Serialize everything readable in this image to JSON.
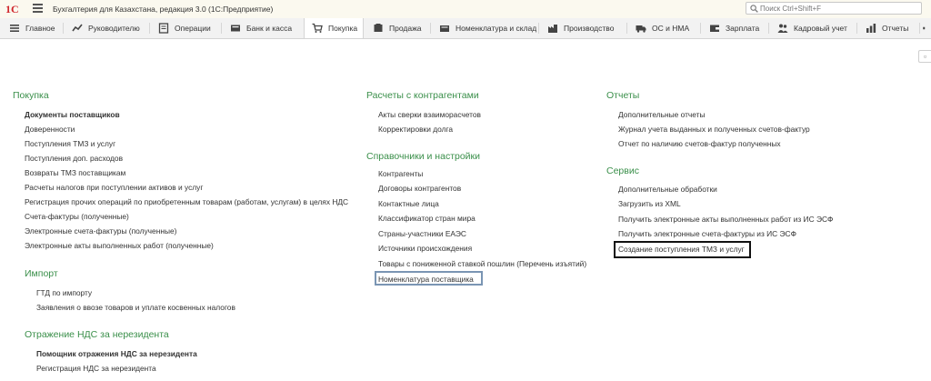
{
  "app": {
    "logo": "1С",
    "title": "Бухгалтерия для Казахстана, редакция 3.0  (1С:Предприятие)",
    "search_placeholder": "Поиск Ctrl+Shift+F"
  },
  "sections": [
    {
      "label": "Главное",
      "icon": "menu-lines-icon"
    },
    {
      "label": "Руководителю",
      "icon": "trend-icon"
    },
    {
      "label": "Операции",
      "icon": "operations-icon"
    },
    {
      "label": "Банк и касса",
      "icon": "bank-icon"
    },
    {
      "label": "Покупка",
      "icon": "cart-icon",
      "active": true
    },
    {
      "label": "Продажа",
      "icon": "sale-icon"
    },
    {
      "label": "Номенклатура и склад",
      "icon": "warehouse-icon"
    },
    {
      "label": "Производство",
      "icon": "factory-icon"
    },
    {
      "label": "ОС и НМА",
      "icon": "truck-icon"
    },
    {
      "label": "Зарплата",
      "icon": "wallet-icon"
    },
    {
      "label": "Кадровый учет",
      "icon": "people-icon"
    },
    {
      "label": "Отчеты",
      "icon": "report-icon"
    }
  ],
  "corner_button": "▫",
  "groups": {
    "pokupka": {
      "title": "Покупка",
      "items": [
        "Документы поставщиков",
        "Доверенности",
        "Поступления ТМЗ и услуг",
        "Поступления доп. расходов",
        "Возвраты ТМЗ поставщикам",
        "Расчеты налогов при поступлении активов и услуг",
        "Регистрация прочих операций по приобретенным товарам (работам, услугам) в целях НДС",
        "Счета-фактуры (полученные)",
        "Электронные счета-фактуры (полученные)",
        "Электронные акты выполненных работ (полученные)"
      ]
    },
    "import": {
      "title": "Импорт",
      "items": [
        "ГТД по импорту",
        "Заявления о ввозе товаров и уплате косвенных налогов"
      ]
    },
    "nds_nonresident": {
      "title": "Отражение НДС за нерезидента",
      "items": [
        "Помощник отражения НДС за нерезидента",
        "Регистрация НДС за нерезидента"
      ]
    },
    "raschety": {
      "title": "Расчеты с контрагентами",
      "items": [
        "Акты сверки взаиморасчетов",
        "Корректировки долга"
      ]
    },
    "spravochniki": {
      "title": "Справочники и настройки",
      "items": [
        "Контрагенты",
        "Договоры контрагентов",
        "Контактные лица",
        "Классификатор стран мира",
        "Страны-участники ЕАЭС",
        "Источники происхождения",
        "Товары с пониженной ставкой пошлин (Перечень изъятий)",
        "Номенклатура поставщика"
      ]
    },
    "otchety": {
      "title": "Отчеты",
      "items": [
        "Дополнительные отчеты",
        "Журнал учета выданных и полученных счетов-фактур",
        "Отчет по наличию счетов-фактур полученных"
      ]
    },
    "servis": {
      "title": "Сервис",
      "items": [
        "Дополнительные обработки",
        "Загрузить из XML",
        "Получить электронные акты выполненных работ из ИС ЭСФ",
        "Получить электронные счета-фактуры из ИС ЭСФ",
        "Создание поступления ТМЗ и услуг"
      ]
    }
  }
}
